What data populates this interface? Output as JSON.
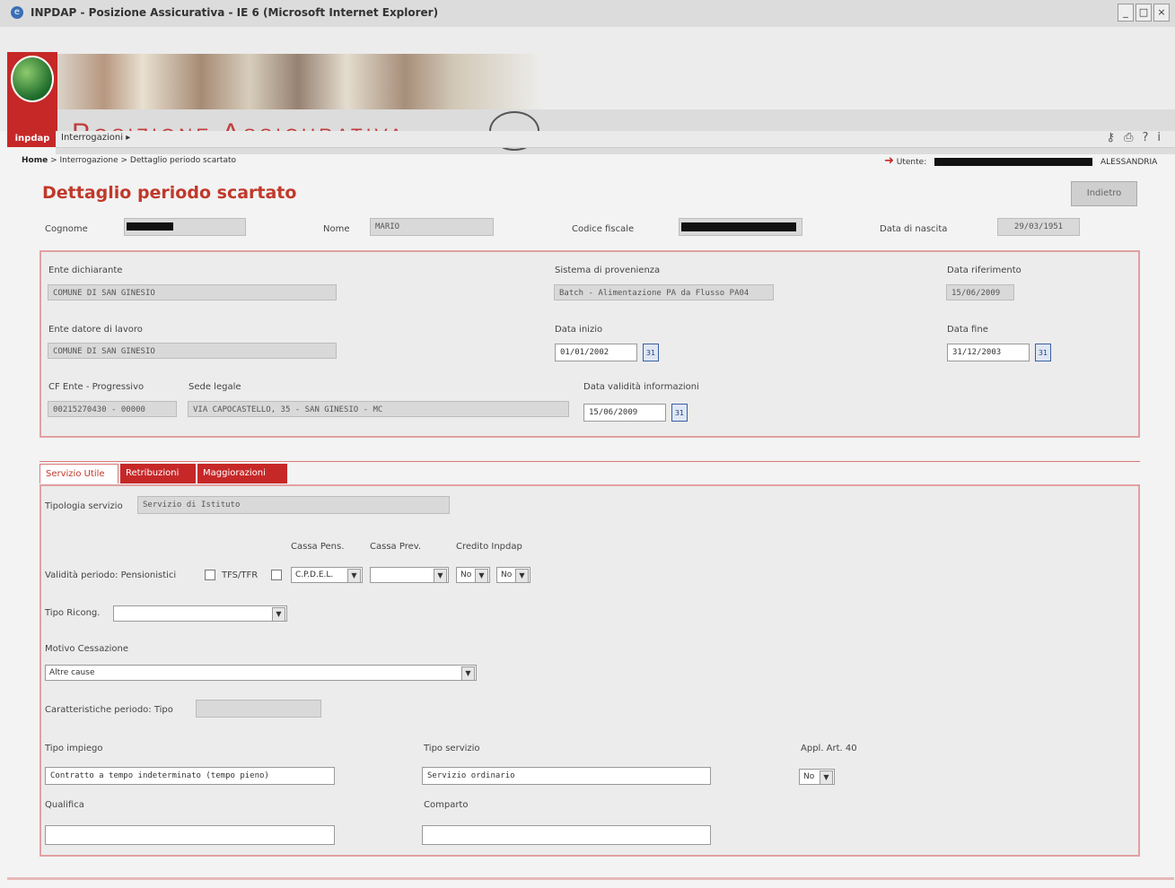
{
  "window": {
    "title": "INPDAP - Posizione Assicurativa - IE 6 (Microsoft Internet Explorer)",
    "controls": [
      "_",
      "□",
      "×"
    ]
  },
  "app": {
    "title": "Posizione Assicurativa",
    "logo_text": "inpdap"
  },
  "menu": {
    "item": "Interrogazioni ▸"
  },
  "breadcrumb": {
    "home": "Home",
    "path": " > Interrogazione > Dettaglio periodo scartato"
  },
  "user": {
    "label": "Utente:",
    "name": "ALESSANDRIA"
  },
  "page": {
    "title": "Dettaglio periodo scartato",
    "back_button": "Indietro"
  },
  "person": {
    "cognome_label": "Cognome",
    "nome_label": "Nome",
    "nome_value": "MARIO",
    "cf_label": "Codice fiscale",
    "nascita_label": "Data di nascita",
    "nascita_value": "29/03/1951"
  },
  "period": {
    "ente_dichiarante_label": "Ente dichiarante",
    "ente_dichiarante_value": "COMUNE DI SAN GINESIO",
    "sistema_label": "Sistema di provenienza",
    "sistema_value": "Batch - Alimentazione PA da Flusso PA04",
    "data_rif_label": "Data riferimento",
    "data_rif_value": "15/06/2009",
    "ente_datore_label": "Ente datore di lavoro",
    "ente_datore_value": "COMUNE DI SAN GINESIO",
    "data_inizio_label": "Data inizio",
    "data_inizio_value": "01/01/2002",
    "data_fine_label": "Data fine",
    "data_fine_value": "31/12/2003",
    "cf_ente_label": "CF Ente - Progressivo",
    "cf_ente_value": "00215270430 - 00000",
    "sede_label": "Sede legale",
    "sede_value": "VIA CAPOCASTELLO, 35 - SAN GINESIO - MC",
    "validita_label": "Data validità informazioni",
    "validita_value": "15/06/2009",
    "cal_icon": "31"
  },
  "tabs": [
    "Servizio Utile",
    "Retribuzioni",
    "Maggiorazioni"
  ],
  "servizio": {
    "tipologia_label": "Tipologia servizio",
    "tipologia_value": "Servizio di Istituto",
    "cassa_pens_label": "Cassa Pens.",
    "cassa_prev_label": "Cassa Prev.",
    "credito_label": "Credito Inpdap",
    "validita_label": "Validità periodo: Pensionistici",
    "tfs_label": "TFS/TFR",
    "cassa_pens_value": "C.P.D.E.L.",
    "cassa_prev_value": "",
    "credito1_value": "No",
    "credito2_value": "No",
    "tipo_ricong_label": "Tipo Ricong.",
    "tipo_ricong_value": "",
    "motivo_label": "Motivo Cessazione",
    "motivo_value": "Altre cause",
    "caratteristiche_label": "Caratteristiche periodo: Tipo",
    "tipo_impiego_label": "Tipo impiego",
    "tipo_impiego_value": "Contratto a tempo indeterminato (tempo pieno)",
    "tipo_servizio_label": "Tipo servizio",
    "tipo_servizio_value": "Servizio ordinario",
    "appl_label": "Appl. Art. 40",
    "appl_value": "No",
    "qualifica_label": "Qualifica",
    "qualifica_value": "",
    "comparto_label": "Comparto",
    "comparto_value": "",
    "dropdown_icon": "▼"
  }
}
